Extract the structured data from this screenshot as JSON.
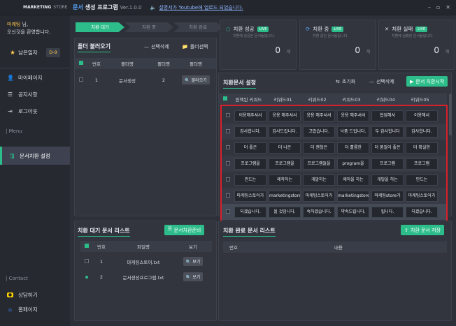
{
  "titlebar": {
    "logo_main": "MARKETING",
    "logo_store": "STORE",
    "title_accent": "문서",
    "title_rest": "생성 프로그램",
    "version": "Ver.1.0.0",
    "notice": "설명서가 Youtube에 업로드 되었습니다.",
    "win_min": "–",
    "win_max": "▫",
    "win_close": "✕"
  },
  "user": {
    "name": "마케팅",
    "suffix": " 님,",
    "greeting": "오신것을 환영합니다.",
    "grade": "남은일자",
    "dday": "D-9"
  },
  "nav": {
    "mypage": "마이페이지",
    "notice": "공지사항",
    "logout": "로그아웃",
    "menu_label": "| Menu",
    "doc_replace": "문서치환 설정",
    "contact_label": "| Contact",
    "consult": "상담하기",
    "home": "홈페이지"
  },
  "steps": [
    "치환 대기",
    "치환 중",
    "치환 완료"
  ],
  "stats": [
    {
      "title": "치환 성공",
      "sub": "치환에 성공한 문서들입니다.",
      "value": "0",
      "unit": "개"
    },
    {
      "title": "치환 중",
      "sub": "치환 중인 문서들입니다.",
      "value": "0",
      "unit": "개"
    },
    {
      "title": "치환 실패",
      "sub": "치환에 실패한 문서들입니다.",
      "value": "0",
      "unit": "개"
    }
  ],
  "folder": {
    "title": "폴더 불러오기",
    "delete_btn": "선택삭제",
    "select_btn": "폴더선택",
    "headers": [
      "번호",
      "폴더명",
      "폴더명",
      "폴더명"
    ],
    "rows": [
      {
        "no": "1",
        "name": "문서생성",
        "count": "2",
        "btn": "불러오기"
      }
    ]
  },
  "replace": {
    "title": "치환문서 설정",
    "reset_btn": "초기화",
    "delete_btn": "선택삭제",
    "start_btn": "문서 치환시작",
    "headers": [
      "원핵된 키워드",
      "키워드01",
      "키워드02",
      "키워드03",
      "키워드04",
      "키워드05"
    ],
    "rows": [
      [
        "이용해주셔서",
        "응용 해주셔서",
        "응용 해주셔서",
        "응용 해주셔서",
        "협업해서",
        "이용해서"
      ],
      [
        "감사합니다.",
        "감사드립니다.",
        "고맙습니다.",
        "낙품 드립니다.",
        "두 감사합니다",
        "감사합니다."
      ],
      [
        "더 좋은",
        "더 나은",
        "더 괜찮은",
        "더 훌륭한",
        "더 품질이 좋은",
        "더 확실한"
      ],
      [
        "프로그램을",
        "프로그램을",
        "프로그램들을",
        "program을",
        "프로그램",
        "프로그램"
      ],
      [
        "만드는",
        "제작하는",
        "개발하는",
        "제작을 하는",
        "개발을 하는",
        "만드는"
      ],
      [
        "마케팅스토어가",
        "marketingstore가",
        "마케팅스토어가",
        "marketingstore가",
        "마케팅store가",
        "마케팅스토어가"
      ],
      [
        "되겠습니다.",
        "될 것입니다.",
        "속하겠습니다.",
        "약속드립니다.",
        "됩니다.",
        "되겠습니다."
      ]
    ]
  },
  "waiting": {
    "title": "치환 대기 문서 리스트",
    "prep_btn": "문서치환준비",
    "headers": [
      "번호",
      "파일명",
      "보기"
    ],
    "rows": [
      {
        "no": "1",
        "name": "마케팅스토어.txt",
        "btn": "보기"
      },
      {
        "no": "2",
        "name": "문서생성프로그램.txt",
        "btn": "보기"
      }
    ]
  },
  "done": {
    "title": "치환 완료 문서 리스트",
    "save_btn": "치환 문서 저장",
    "headers": [
      "번호",
      "내용"
    ]
  }
}
